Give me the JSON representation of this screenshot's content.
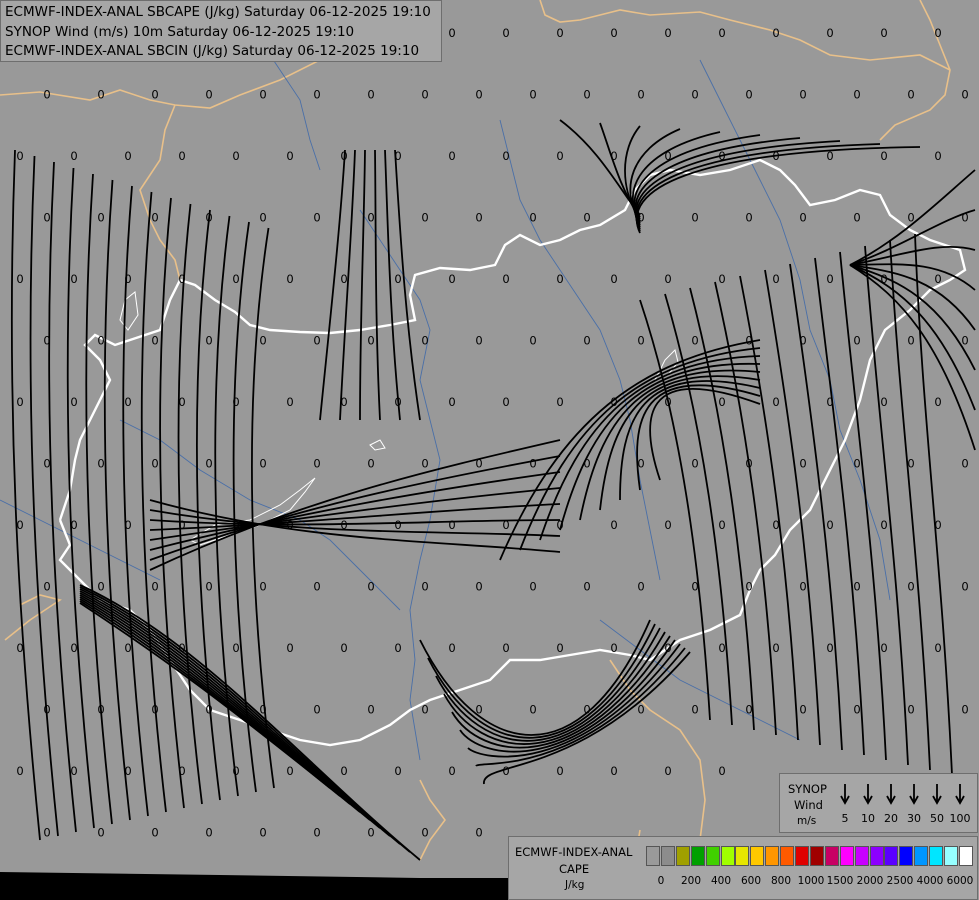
{
  "titles": {
    "line1": "ECMWF-INDEX-ANAL SBCAPE (J/kg) Saturday 06-12-2025 19:10",
    "line2": "SYNOP Wind (m/s) 10m Saturday 06-12-2025 19:10",
    "line3": "ECMWF-INDEX-ANAL SBCIN (J/kg) Saturday 06-12-2025 19:10"
  },
  "colors": {
    "background": "#999999",
    "border_country": "#ffffff",
    "border_neighbor": "#e8c08a",
    "rivers": "#4a6fa8",
    "streamlines": "#000000"
  },
  "grid_value": "0",
  "wind_legend": {
    "title": "SYNOP",
    "subtitle": "Wind",
    "unit": "m/s",
    "values": [
      "5",
      "10",
      "20",
      "30",
      "50",
      "100"
    ]
  },
  "cape_legend": {
    "title": "ECMWF-INDEX-ANAL",
    "subtitle": "CAPE",
    "unit": "J/kg",
    "labels": [
      "0",
      "200",
      "400",
      "600",
      "800",
      "1000",
      "1500",
      "2000",
      "2500",
      "4000",
      "6000"
    ],
    "colors": [
      "#9a9a9a",
      "#8c8c8c",
      "#a0a000",
      "#00a000",
      "#40d000",
      "#a0ff00",
      "#e6e600",
      "#ffc800",
      "#ff9600",
      "#ff5a00",
      "#e00000",
      "#a00000",
      "#c80064",
      "#ff00ff",
      "#c800ff",
      "#8c00ff",
      "#5a00ff",
      "#0000ff",
      "#0096ff",
      "#00e6ff",
      "#96ffff",
      "#ffffff"
    ]
  }
}
